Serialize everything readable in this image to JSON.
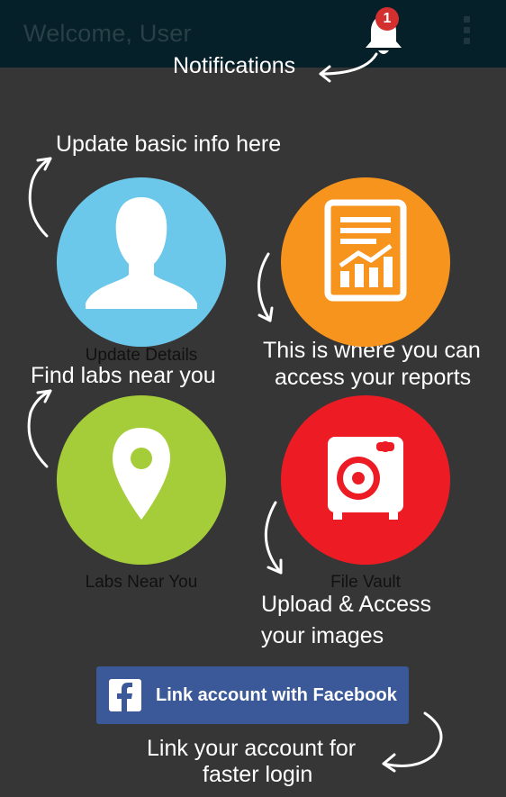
{
  "app_bar": {
    "title": "Welcome, User",
    "notification_count": "1",
    "bell_icon": "bell-icon",
    "menu_icon": "overflow-menu-icon"
  },
  "hints": {
    "notifications": "Notifications",
    "update_info": "Update basic info here",
    "reports_line1": "This is where you can",
    "reports_line2": "access your reports",
    "labs": "Find labs near you",
    "upload_line1": "Upload & Access",
    "upload_line2": "your images",
    "link_line1": "Link your account for",
    "link_line2": "faster login"
  },
  "tiles": [
    {
      "label": "Update Details",
      "icon": "user-silhouette-icon",
      "color": "#6cc8ea"
    },
    {
      "label": "",
      "icon": "report-chart-icon",
      "color": "#f7941d"
    },
    {
      "label": "Labs Near You",
      "icon": "location-pin-icon",
      "color": "#a5cd39"
    },
    {
      "label": "File Vault",
      "icon": "safe-vault-icon",
      "color": "#ed1c24"
    }
  ],
  "facebook_button": {
    "label": "Link account with Facebook",
    "icon": "facebook-icon",
    "color": "#3b5998"
  }
}
